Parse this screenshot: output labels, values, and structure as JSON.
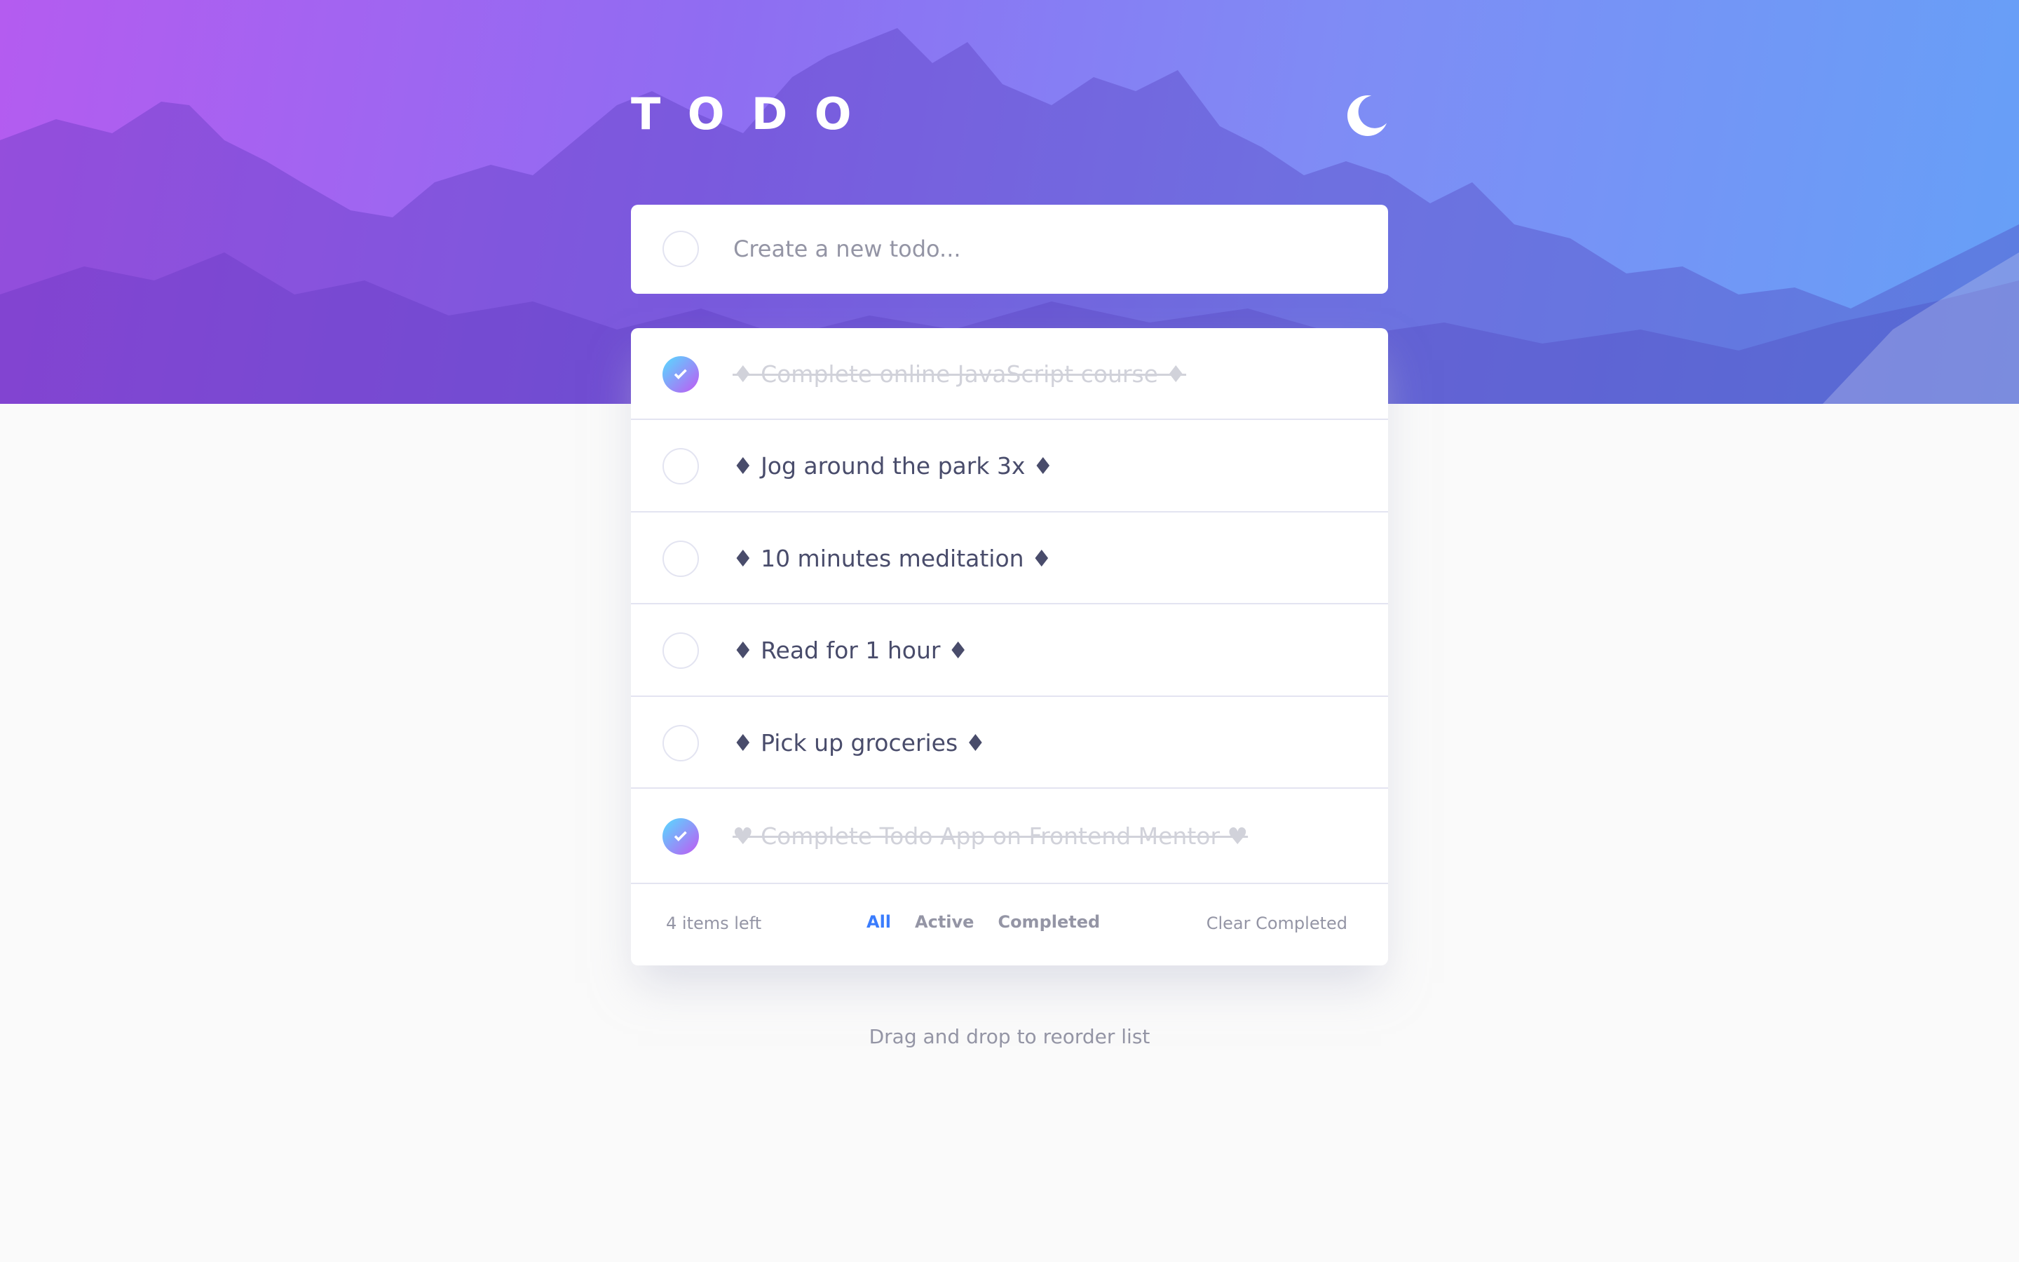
{
  "header": {
    "title": "TODO",
    "theme_toggle_icon": "moon-icon"
  },
  "new_todo": {
    "placeholder": "Create a new todo...",
    "value": ""
  },
  "todos": [
    {
      "text": "♦ Complete online JavaScript course ♦",
      "completed": true
    },
    {
      "text": "♦ Jog around the park 3x ♦",
      "completed": false
    },
    {
      "text": "♦ 10 minutes meditation ♦",
      "completed": false
    },
    {
      "text": "♦ Read for 1 hour ♦",
      "completed": false
    },
    {
      "text": "♦ Pick up groceries ♦",
      "completed": false
    },
    {
      "text": "♥ Complete Todo App on Frontend Mentor ♥",
      "completed": true
    }
  ],
  "footer": {
    "items_left": "4 items left",
    "filters": [
      {
        "label": "All",
        "active": true
      },
      {
        "label": "Active",
        "active": false
      },
      {
        "label": "Completed",
        "active": false
      }
    ],
    "clear_completed": "Clear Completed"
  },
  "hint": "Drag and drop to reorder list",
  "colors": {
    "page_background": "#fafafa",
    "active_filter": "#3a7cfd",
    "text_primary": "#494c6b",
    "text_muted": "#9495a5",
    "text_completed": "#d1d2da",
    "check_gradient_start": "#55ddff",
    "check_gradient_end": "#c058f3",
    "hero_gradient_start": "#b45cf0",
    "hero_gradient_end": "#66a0f7"
  }
}
